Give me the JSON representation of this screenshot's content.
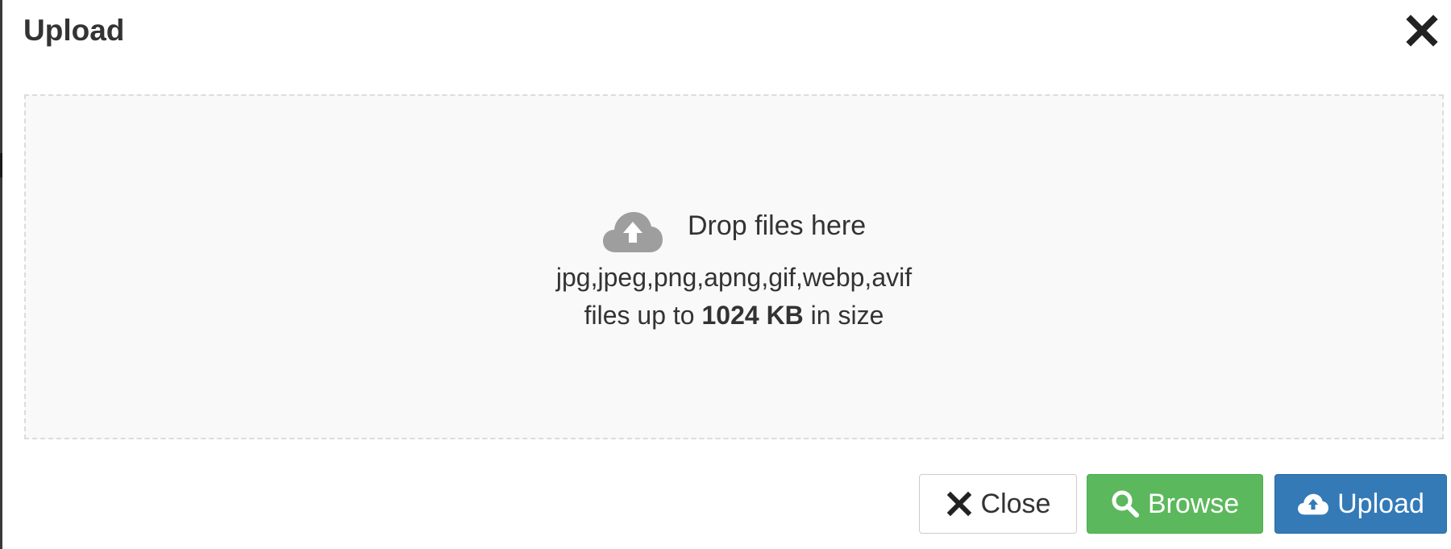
{
  "modal": {
    "title": "Upload",
    "close_icon": "times-icon"
  },
  "dropzone": {
    "icon": "cloud-upload-icon",
    "title": "Drop files here",
    "file_types": "jpg,jpeg,png,apng,gif,webp,avif",
    "size_prefix": "files up to",
    "size_limit": "1024 KB",
    "size_suffix": "in size"
  },
  "footer": {
    "close_label": "Close",
    "browse_label": "Browse",
    "upload_label": "Upload",
    "close_icon": "times-icon",
    "browse_icon": "search-icon",
    "upload_icon": "cloud-upload-icon"
  },
  "colors": {
    "browse": "#5cb85c",
    "upload": "#337ab7",
    "dropzone_bg": "#f9f9f9",
    "icon_gray": "#9e9e9e"
  }
}
